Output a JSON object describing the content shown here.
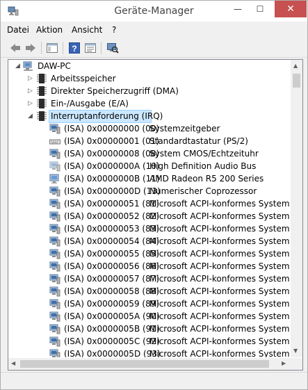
{
  "window": {
    "title": "Geräte-Manager",
    "minimize_glyph": "—",
    "maximize_glyph": "☐",
    "close_glyph": "✕",
    "accent_close": "#c75050"
  },
  "menu": [
    "Datei",
    "Aktion",
    "Ansicht",
    "?"
  ],
  "toolbar_icons": [
    "back-arrow-icon",
    "forward-arrow-icon",
    "show-hide-console-tree-icon",
    "help-icon",
    "properties-icon",
    "scan-hardware-icon"
  ],
  "tree": {
    "root": "DAW-PC",
    "categories": [
      {
        "label": "Arbeitsspeicher",
        "expanded": false
      },
      {
        "label": "Direkter Speicherzugriff (DMA)",
        "expanded": false
      },
      {
        "label": "Ein-/Ausgabe (E/A)",
        "expanded": false
      },
      {
        "label": "Interruptanforderung (IRQ)",
        "expanded": true,
        "selected": true
      }
    ],
    "irq_items": [
      {
        "irq": "(ISA) 0x00000000 (00)",
        "device": "Systemzeitgeber",
        "icon": "system-device-icon"
      },
      {
        "irq": "(ISA) 0x00000001 (01)",
        "device": "Standardtastatur (PS/2)",
        "icon": "keyboard-icon"
      },
      {
        "irq": "(ISA) 0x00000008 (08)",
        "device": "System CMOS/Echtzeituhr",
        "icon": "system-device-icon"
      },
      {
        "irq": "(ISA) 0x0000000A (10)",
        "device": "High Definition Audio Bus",
        "icon": "audio-bus-icon"
      },
      {
        "irq": "(ISA) 0x0000000B (11)",
        "device": "AMD Radeon R5 200 Series",
        "icon": "display-adapter-icon"
      },
      {
        "irq": "(ISA) 0x0000000D (13)",
        "device": "Numerischer Coprozessor",
        "icon": "system-device-icon"
      },
      {
        "irq": "(ISA) 0x00000051 (81)",
        "device": "Microsoft ACPI-konformes System",
        "icon": "system-device-icon"
      },
      {
        "irq": "(ISA) 0x00000052 (82)",
        "device": "Microsoft ACPI-konformes System",
        "icon": "system-device-icon"
      },
      {
        "irq": "(ISA) 0x00000053 (83)",
        "device": "Microsoft ACPI-konformes System",
        "icon": "system-device-icon"
      },
      {
        "irq": "(ISA) 0x00000054 (84)",
        "device": "Microsoft ACPI-konformes System",
        "icon": "system-device-icon"
      },
      {
        "irq": "(ISA) 0x00000055 (85)",
        "device": "Microsoft ACPI-konformes System",
        "icon": "system-device-icon"
      },
      {
        "irq": "(ISA) 0x00000056 (86)",
        "device": "Microsoft ACPI-konformes System",
        "icon": "system-device-icon"
      },
      {
        "irq": "(ISA) 0x00000057 (87)",
        "device": "Microsoft ACPI-konformes System",
        "icon": "system-device-icon"
      },
      {
        "irq": "(ISA) 0x00000058 (88)",
        "device": "Microsoft ACPI-konformes System",
        "icon": "system-device-icon"
      },
      {
        "irq": "(ISA) 0x00000059 (89)",
        "device": "Microsoft ACPI-konformes System",
        "icon": "system-device-icon"
      },
      {
        "irq": "(ISA) 0x0000005A (90)",
        "device": "Microsoft ACPI-konformes System",
        "icon": "system-device-icon"
      },
      {
        "irq": "(ISA) 0x0000005B (91)",
        "device": "Microsoft ACPI-konformes System",
        "icon": "system-device-icon"
      },
      {
        "irq": "(ISA) 0x0000005C (92)",
        "device": "Microsoft ACPI-konformes System",
        "icon": "system-device-icon"
      },
      {
        "irq": "(ISA) 0x0000005D (93)",
        "device": "Microsoft ACPI-konformes System",
        "icon": "system-device-icon"
      }
    ]
  }
}
